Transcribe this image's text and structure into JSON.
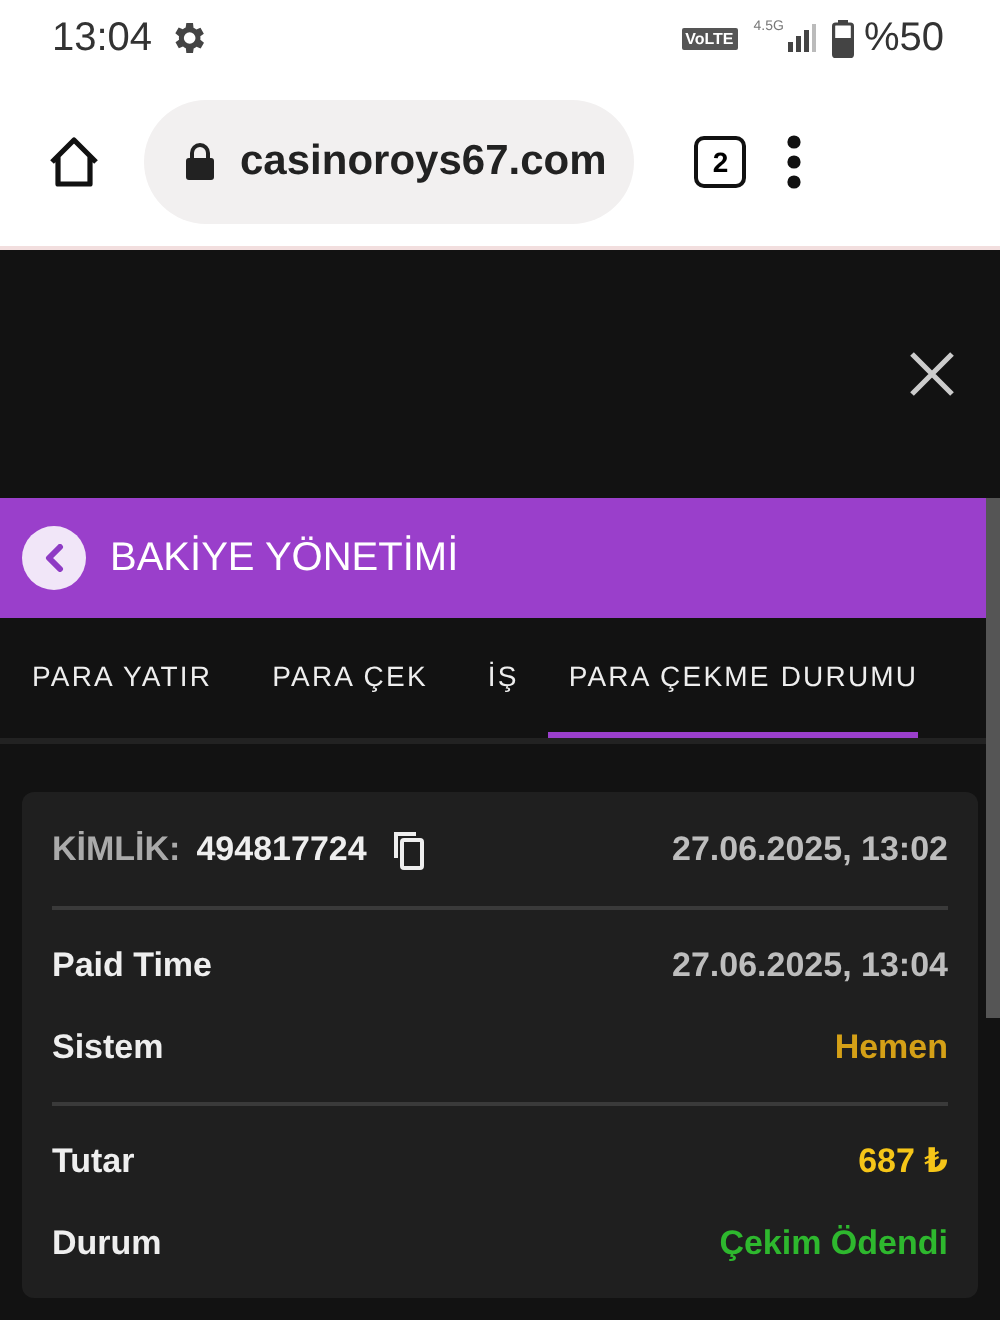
{
  "status_bar": {
    "time": "13:04",
    "network_badge": "VoLTE",
    "network_type": "4.5G",
    "battery": "%50"
  },
  "browser": {
    "url": "casinoroys67.com",
    "tab_count": "2"
  },
  "header": {
    "title": "BAKİYE YÖNETİMİ"
  },
  "tabs": [
    {
      "label": "PARA YATIR",
      "selected": false
    },
    {
      "label": "PARA ÇEK",
      "selected": false
    },
    {
      "label": "İŞ",
      "selected": false
    },
    {
      "label": "PARA ÇEKME DURUMU",
      "selected": true
    }
  ],
  "card": {
    "id_label": "KİMLİK:",
    "id_value": "494817724",
    "created": "27.06.2025, 13:02",
    "groups": [
      {
        "rows": [
          {
            "label": "Paid Time",
            "value": "27.06.2025, 13:04",
            "color": "#bdbdbd"
          },
          {
            "label": "Sistem",
            "value": "Hemen",
            "color": "#d4a017"
          }
        ]
      },
      {
        "rows": [
          {
            "label": "Tutar",
            "value": "687 ₺",
            "color": "#f5c518"
          },
          {
            "label": "Durum",
            "value": "Çekim Ödendi",
            "color": "#2eb82e"
          }
        ]
      }
    ]
  }
}
